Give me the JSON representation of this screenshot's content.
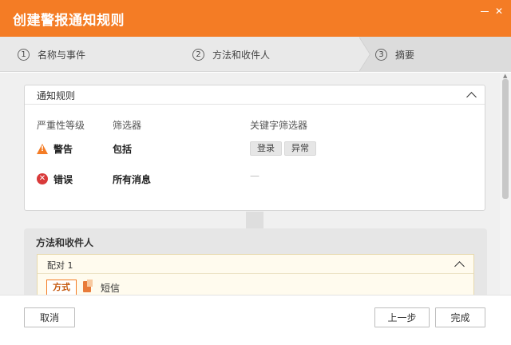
{
  "window": {
    "title": "创建警报通知规则",
    "close_glyph": "✕"
  },
  "steps": [
    {
      "num": "1",
      "label": "名称与事件"
    },
    {
      "num": "2",
      "label": "方法和收件人"
    },
    {
      "num": "3",
      "label": "摘要"
    }
  ],
  "rules_card": {
    "title": "通知规则",
    "columns": {
      "severity": "严重性等级",
      "filter": "筛选器",
      "keyword": "关键字筛选器"
    },
    "rows": [
      {
        "icon": "warning-icon",
        "severity": "警告",
        "filter": "包括",
        "keywords": [
          "登录",
          "异常"
        ]
      },
      {
        "icon": "error-icon",
        "severity": "错误",
        "filter": "所有消息",
        "keyword_empty": "—"
      }
    ]
  },
  "recipients_card": {
    "title": "方法和收件人",
    "pair": {
      "title": "配对 1",
      "tab_label": "方式",
      "method": "短信"
    }
  },
  "footer": {
    "cancel": "取消",
    "prev": "上一步",
    "done": "完成"
  },
  "colors": {
    "accent": "#f47c25",
    "error": "#d93a3a"
  }
}
